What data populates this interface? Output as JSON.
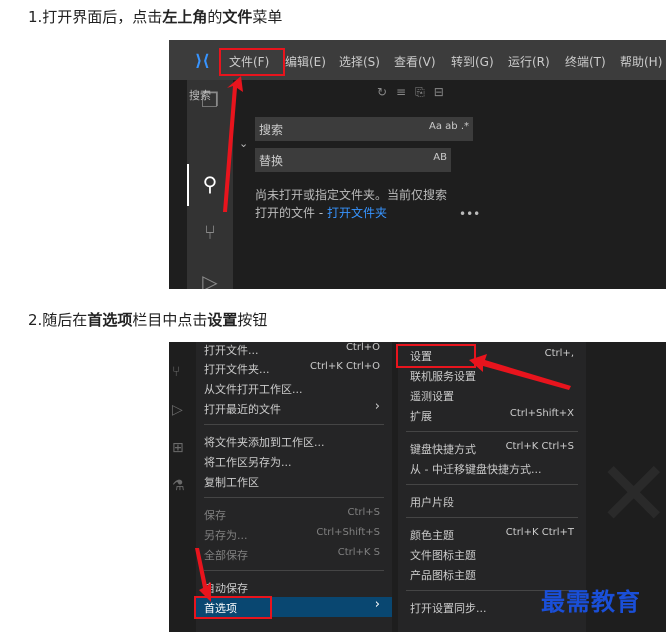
{
  "step1": {
    "prefix": "1.打开界面后，点击",
    "bold1": "左上角",
    "mid": "的",
    "bold2": "文件",
    "suffix": "菜单"
  },
  "step2": {
    "prefix": "2.随后在",
    "bold1": "首选项",
    "mid": "栏目中点击",
    "bold2": "设置",
    "suffix": "按钮"
  },
  "shot1": {
    "menubar": [
      "文件(F)",
      "编辑(E)",
      "选择(S)",
      "查看(V)",
      "转到(G)",
      "运行(R)",
      "终端(T)",
      "帮助(H)"
    ],
    "sidebar_title": "搜索",
    "search_placeholder": "搜索",
    "search_tools": "Aa  ab  .*",
    "replace_placeholder": "替换",
    "replace_tools": "AB",
    "message_line1": "尚未打开或指定文件夹。当前仅搜索",
    "message_line2": "打开的文件 - ",
    "message_link": "打开文件夹",
    "more": "•••"
  },
  "shot2": {
    "file_menu": [
      {
        "label": "打开文件...",
        "shortcut": "Ctrl+O"
      },
      {
        "label": "打开文件夹...",
        "shortcut": "Ctrl+K Ctrl+O"
      },
      {
        "label": "从文件打开工作区...",
        "shortcut": ""
      },
      {
        "label": "打开最近的文件",
        "shortcut": "›"
      },
      {
        "label": "将文件夹添加到工作区...",
        "shortcut": ""
      },
      {
        "label": "将工作区另存为...",
        "shortcut": ""
      },
      {
        "label": "复制工作区",
        "shortcut": ""
      },
      {
        "label": "保存",
        "shortcut": "Ctrl+S"
      },
      {
        "label": "另存为...",
        "shortcut": "Ctrl+Shift+S"
      },
      {
        "label": "全部保存",
        "shortcut": "Ctrl+K S"
      },
      {
        "label": "自动保存",
        "shortcut": ""
      },
      {
        "label": "首选项",
        "shortcut": "›"
      }
    ],
    "pref_menu": [
      {
        "label": "设置",
        "shortcut": "Ctrl+,"
      },
      {
        "label": "联机服务设置",
        "shortcut": ""
      },
      {
        "label": "遥测设置",
        "shortcut": ""
      },
      {
        "label": "扩展",
        "shortcut": "Ctrl+Shift+X"
      },
      {
        "label": "键盘快捷方式",
        "shortcut": "Ctrl+K Ctrl+S"
      },
      {
        "label": "从 - 中迁移键盘快捷方式...",
        "shortcut": ""
      },
      {
        "label": "用户片段",
        "shortcut": ""
      },
      {
        "label": "颜色主题",
        "shortcut": "Ctrl+K Ctrl+T"
      },
      {
        "label": "文件图标主题",
        "shortcut": ""
      },
      {
        "label": "产品图标主题",
        "shortcut": ""
      },
      {
        "label": "打开设置同步...",
        "shortcut": ""
      }
    ],
    "watermark": "最需教育"
  },
  "colors": {
    "highlight": "#e8141d",
    "selection": "#094771",
    "link": "#3794ff"
  }
}
